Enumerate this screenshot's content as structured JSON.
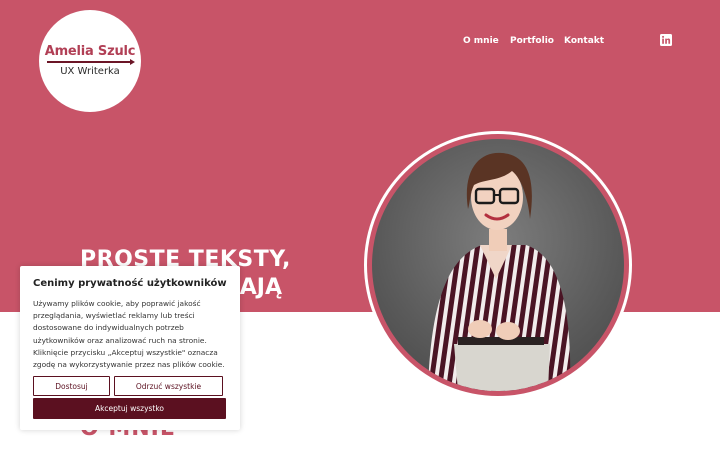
{
  "colors": {
    "brand": "#c85468",
    "dark_accent": "#5b1020"
  },
  "logo": {
    "name": "Amelia Szulc",
    "role": "UX Writerka"
  },
  "nav": {
    "items": [
      "O mnie",
      "Portfolio",
      "Kontakt"
    ],
    "social_icon": "linkedin-icon"
  },
  "hero": {
    "headline_line1": "PROSTE TEKSTY,",
    "headline_line2": "AJĄ"
  },
  "about": {
    "heading": "O MNIE"
  },
  "cookie_banner": {
    "title": "Cenimy prywatność użytkowników",
    "lines": [
      "Używamy plików cookie, aby poprawić jakość",
      "przeglądania, wyświetlać reklamy lub treści",
      "dostosowane do indywidualnych potrzeb",
      "użytkowników oraz analizować ruch na stronie.",
      "Kliknięcie przycisku „Akceptuj wszystkie\" oznacza",
      "zgodę na wykorzystywanie przez nas plików cookie."
    ],
    "customize_label": "Dostosuj",
    "reject_label": "Odrzuć wszystkie",
    "accept_label": "Akceptuj wszystko"
  }
}
